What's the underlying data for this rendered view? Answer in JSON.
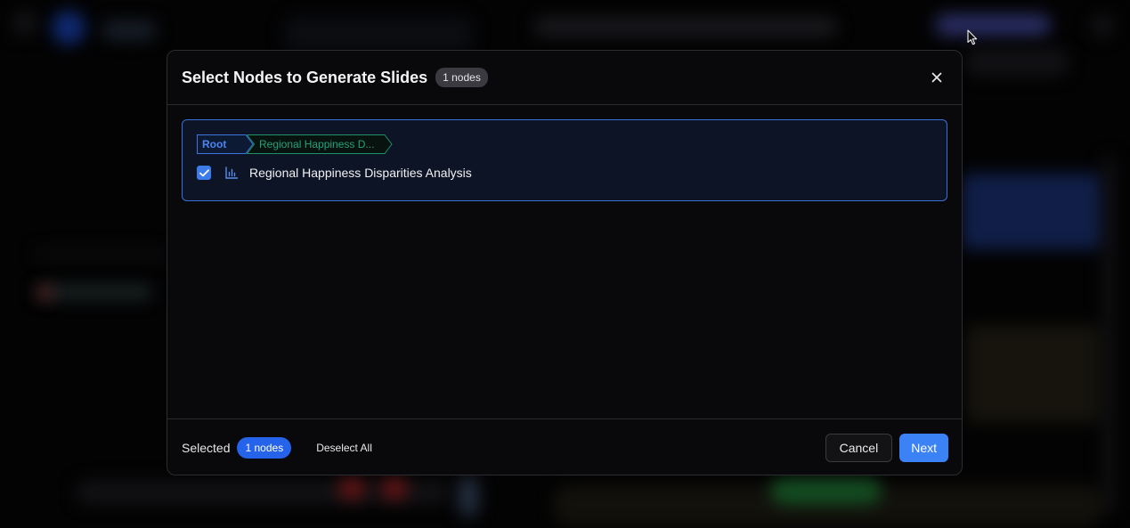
{
  "modal": {
    "title": "Select Nodes to Generate Slides",
    "count_badge": "1 nodes",
    "close_icon": "close-icon"
  },
  "breadcrumb": {
    "items": [
      "Root",
      "Regional Happiness D..."
    ],
    "colors": {
      "root": "#4b86f0",
      "current": "#22a37a"
    }
  },
  "node": {
    "label": "Regional Happiness Disparities Analysis",
    "checked": true,
    "icon": "bar-chart-icon"
  },
  "footer": {
    "selected_label": "Selected",
    "selected_badge": "1 nodes",
    "deselect_label": "Deselect All",
    "cancel_label": "Cancel",
    "next_label": "Next"
  },
  "colors": {
    "accent": "#3b82f6",
    "badge": "#2563eb",
    "card_border": "#3d6fd8"
  }
}
